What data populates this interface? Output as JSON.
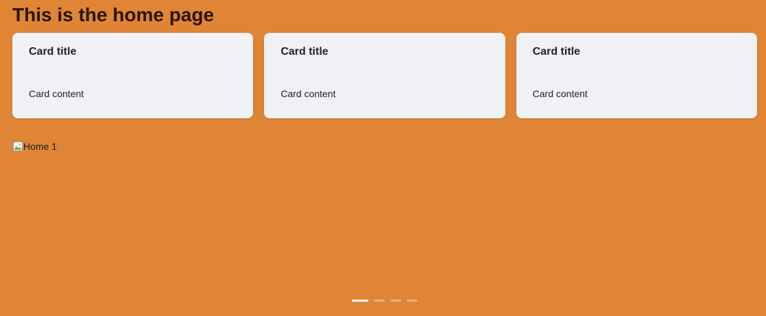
{
  "page": {
    "title": "This is the home page",
    "background_color": "#e08435"
  },
  "cards": [
    {
      "title": "Card title",
      "content": "Card content"
    },
    {
      "title": "Card title",
      "content": "Card content"
    },
    {
      "title": "Card title",
      "content": "Card content"
    }
  ],
  "carousel": {
    "image_alt": "Home 1",
    "image_icon": "broken-image-icon",
    "active_index": 0,
    "dot_count": 4
  }
}
